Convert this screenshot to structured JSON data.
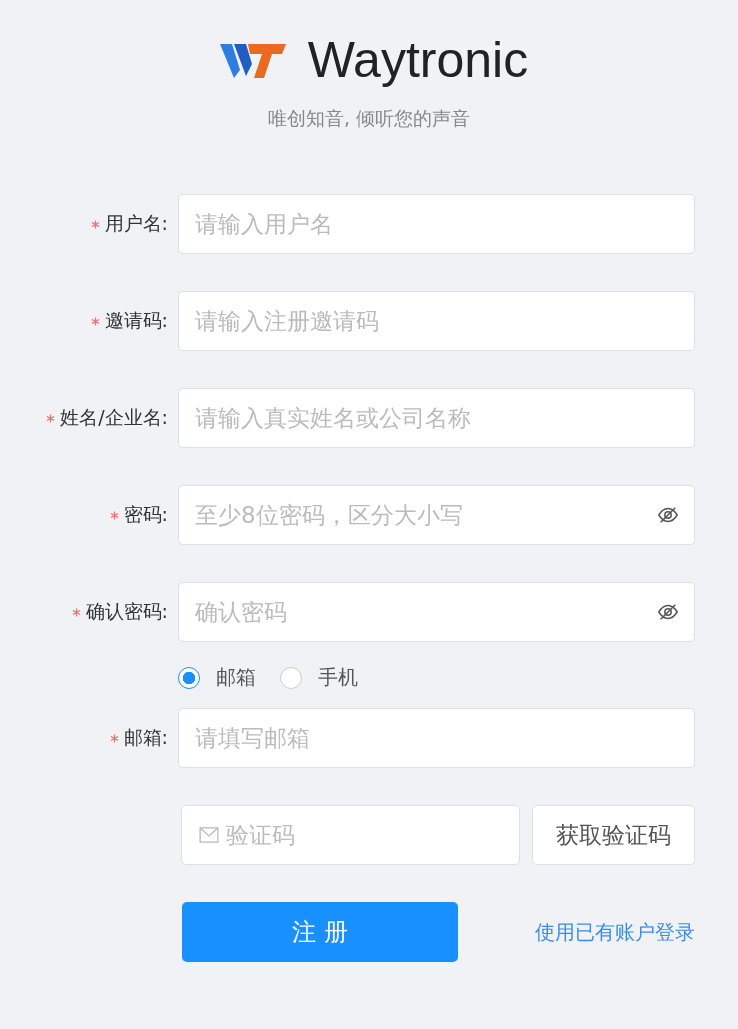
{
  "brand": {
    "name": "Waytronic",
    "slogan": "唯创知音, 倾听您的声音"
  },
  "fields": [
    {
      "label": "用户名:",
      "required": true,
      "kind": "text",
      "placeholder": "请输入用户名"
    },
    {
      "label": "邀请码:",
      "required": true,
      "kind": "text",
      "placeholder": "请输入注册邀请码"
    },
    {
      "label": "姓名/企业名:",
      "required": true,
      "kind": "text",
      "placeholder": "请输入真实姓名或公司名称"
    },
    {
      "label": "密码:",
      "required": true,
      "kind": "password",
      "placeholder": "至少8位密码，区分大小写"
    },
    {
      "label": "确认密码:",
      "required": true,
      "kind": "password",
      "placeholder": "确认密码"
    }
  ],
  "contact_type": [
    {
      "label": "邮箱",
      "selected": true
    },
    {
      "label": "手机",
      "selected": false
    }
  ],
  "contact_field": {
    "label": "邮箱:",
    "required": true,
    "placeholder": "请填写邮箱"
  },
  "code_field": {
    "placeholder": "验证码"
  },
  "code_button": "获取验证码",
  "register_button": "注 册",
  "login_link": "使用已有账户登录"
}
